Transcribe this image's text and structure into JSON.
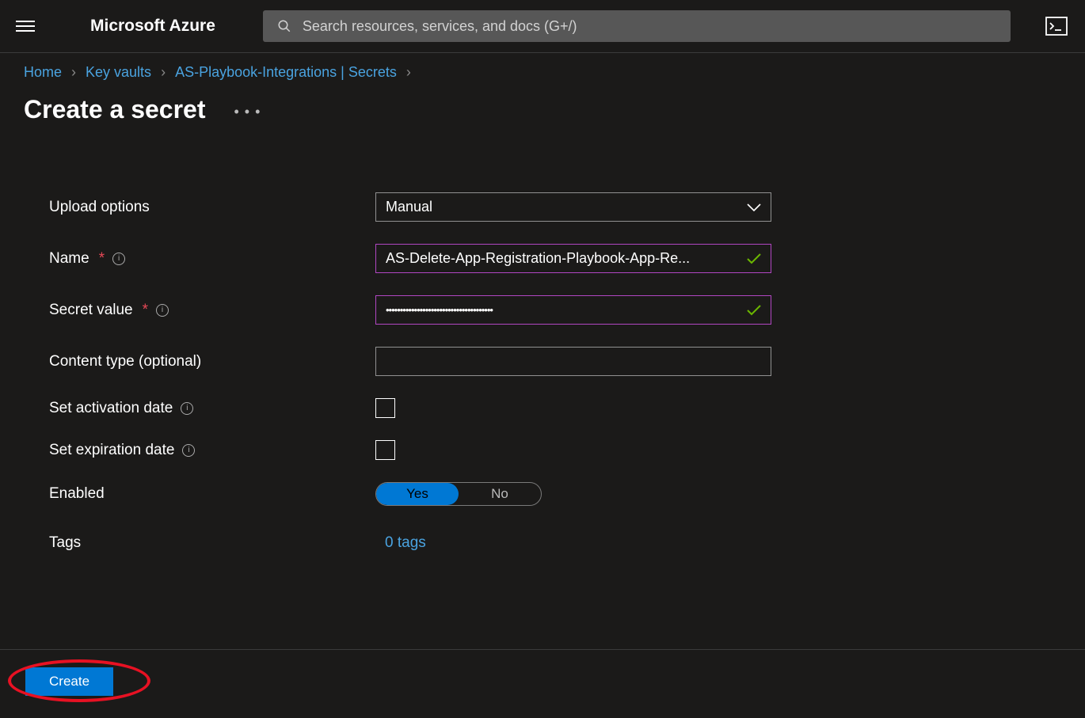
{
  "header": {
    "logo": "Microsoft Azure",
    "search_placeholder": "Search resources, services, and docs (G+/)"
  },
  "breadcrumb": {
    "items": [
      "Home",
      "Key vaults",
      "AS-Playbook-Integrations | Secrets"
    ]
  },
  "page": {
    "title": "Create a secret"
  },
  "form": {
    "upload_options": {
      "label": "Upload options",
      "value": "Manual"
    },
    "name": {
      "label": "Name",
      "value": "AS-Delete-App-Registration-Playbook-App-Re..."
    },
    "secret_value": {
      "label": "Secret value",
      "value": "••••••••••••••••••••••••••••••••••••••"
    },
    "content_type": {
      "label": "Content type (optional)",
      "value": ""
    },
    "activation_date": {
      "label": "Set activation date"
    },
    "expiration_date": {
      "label": "Set expiration date"
    },
    "enabled": {
      "label": "Enabled",
      "yes": "Yes",
      "no": "No"
    },
    "tags": {
      "label": "Tags",
      "value": "0 tags"
    }
  },
  "footer": {
    "create_label": "Create"
  }
}
